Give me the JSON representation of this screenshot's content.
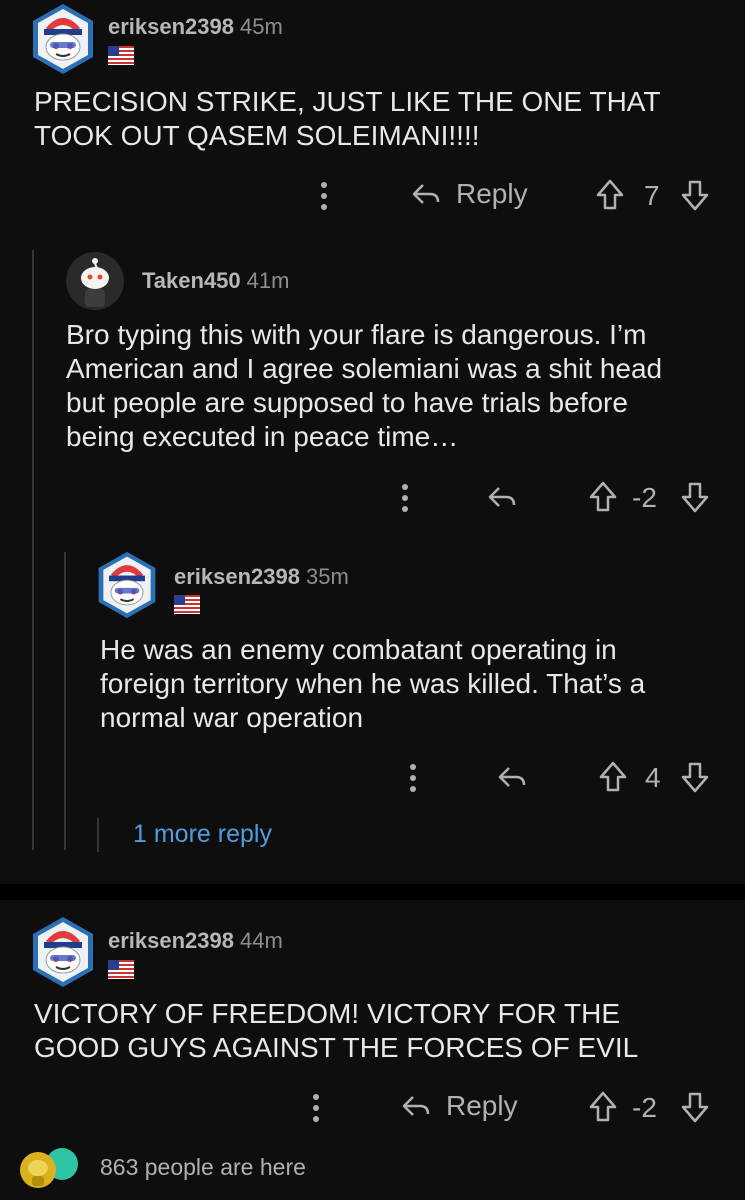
{
  "comments": [
    {
      "user": "eriksen2398",
      "age": "45m",
      "text": "PRECISION STRIKE, JUST LIKE THE ONE THAT TOOK OUT QASEM SOLEIMANI!!!!",
      "reply_label": "Reply",
      "votes": "7"
    },
    {
      "user": "Taken450",
      "age": "41m",
      "text": "Bro typing this with your flare is dangerous. I’m American and I agree solemiani was a shit head but people are supposed to have trials before being executed in peace time…",
      "votes": "-2"
    },
    {
      "user": "eriksen2398",
      "age": "35m",
      "text": "He was an enemy combatant operating in foreign territory when he was killed. That’s a normal war operation",
      "votes": "4"
    },
    {
      "user": "eriksen2398",
      "age": "44m",
      "text": "VICTORY OF FREEDOM! VICTORY FOR THE GOOD GUYS AGAINST THE FORCES OF EVIL",
      "reply_label": "Reply",
      "votes": "-2"
    }
  ],
  "more_replies": "1 more reply",
  "presence": "863 people are here",
  "colors": {
    "background": "#0e0e0e",
    "link": "#4f9de0",
    "muted": "#aeb2b5"
  }
}
